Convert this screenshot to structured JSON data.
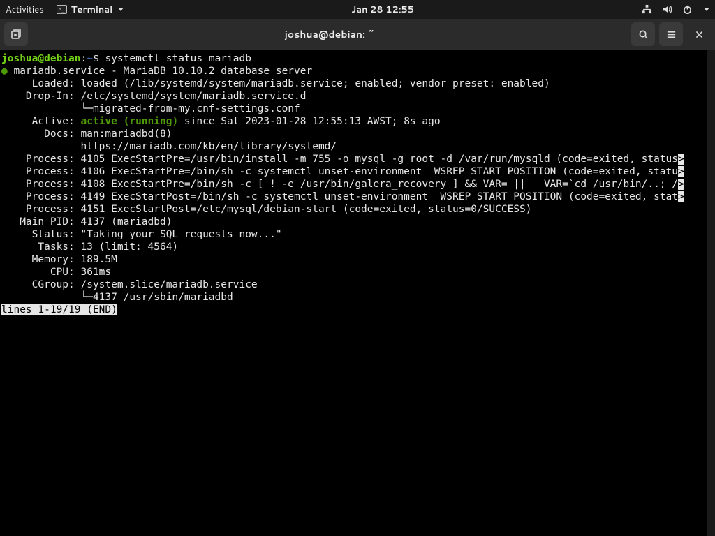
{
  "topbar": {
    "activities": "Activities",
    "app_name": "Terminal",
    "clock": "Jan 28  12:55"
  },
  "window": {
    "title": "joshua@debian: ~"
  },
  "prompt": {
    "user_host": "joshua@debian",
    "colon": ":",
    "path": "~",
    "dollar": "$",
    "command": "systemctl status mariadb"
  },
  "svc": {
    "bullet": "●",
    "header": "mariadb.service - MariaDB 10.10.2 database server",
    "loaded_label": "     Loaded: ",
    "loaded_value": "loaded (/lib/systemd/system/mariadb.service; enabled; vendor preset: enabled)",
    "dropin_label": "    Drop-In: ",
    "dropin_value": "/etc/systemd/system/mariadb.service.d",
    "dropin_cont": "             └─migrated-from-my.cnf-settings.conf",
    "active_label": "     Active: ",
    "active_value": "active (running)",
    "active_rest": " since Sat 2023-01-28 12:55:13 AWST; 8s ago",
    "docs_label": "       Docs: ",
    "docs_value": "man:mariadbd(8)",
    "docs_cont": "             https://mariadb.com/kb/en/library/systemd/",
    "proc1": "    Process: 4105 ExecStartPre=/usr/bin/install -m 755 -o mysql -g root -d /var/run/mysqld (code=exited, status",
    "proc2": "    Process: 4106 ExecStartPre=/bin/sh -c systemctl unset-environment _WSREP_START_POSITION (code=exited, statu",
    "proc3": "    Process: 4108 ExecStartPre=/bin/sh -c [ ! -e /usr/bin/galera_recovery ] && VAR= ||   VAR=`cd /usr/bin/..; /",
    "proc4": "    Process: 4149 ExecStartPost=/bin/sh -c systemctl unset-environment _WSREP_START_POSITION (code=exited, stat",
    "proc5": "    Process: 4151 ExecStartPost=/etc/mysql/debian-start (code=exited, status=0/SUCCESS)",
    "mainpid": "   Main PID: 4137 (mariadbd)",
    "status": "     Status: \"Taking your SQL requests now...\"",
    "tasks": "      Tasks: 13 (limit: 4564)",
    "memory": "     Memory: 189.5M",
    "cpu": "        CPU: 361ms",
    "cgroup": "     CGroup: /system.slice/mariadb.service",
    "cgroup_cont": "             └─4137 /usr/sbin/mariadbd",
    "overflow_marker": ">"
  },
  "pager": {
    "line": "lines 1-19/19 (END)"
  }
}
